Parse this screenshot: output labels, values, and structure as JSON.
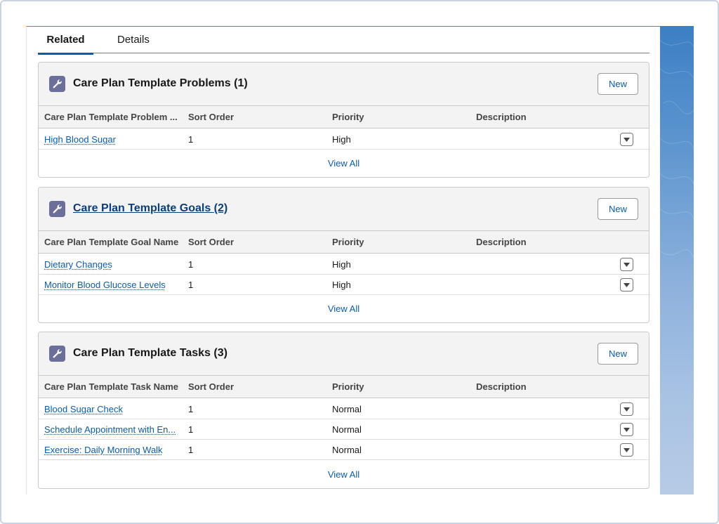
{
  "tabs": {
    "related": "Related",
    "details": "Details"
  },
  "columns": {
    "sort": "Sort Order",
    "priority": "Priority",
    "description": "Description"
  },
  "problems": {
    "title": "Care Plan Template Problems (1)",
    "new_label": "New",
    "name_header": "Care Plan Template Problem ...",
    "rows": [
      {
        "name": "High Blood Sugar",
        "sort": "1",
        "priority": "High",
        "description": ""
      }
    ],
    "view_all": "View All"
  },
  "goals": {
    "title": "Care Plan Template Goals (2)",
    "new_label": "New",
    "name_header": "Care Plan Template Goal Name",
    "rows": [
      {
        "name": "Dietary Changes",
        "sort": "1",
        "priority": "High",
        "description": ""
      },
      {
        "name": "Monitor Blood Glucose Levels",
        "sort": "1",
        "priority": "High",
        "description": ""
      }
    ],
    "view_all": "View All"
  },
  "tasks": {
    "title": "Care Plan Template Tasks (3)",
    "new_label": "New",
    "name_header": "Care Plan Template Task Name",
    "rows": [
      {
        "name": "Blood Sugar Check",
        "sort": "1",
        "priority": "Normal",
        "description": ""
      },
      {
        "name": "Schedule Appointment with En...",
        "sort": "1",
        "priority": "Normal",
        "description": ""
      },
      {
        "name": "Exercise: Daily Morning Walk",
        "sort": "1",
        "priority": "Normal",
        "description": ""
      }
    ],
    "view_all": "View All"
  },
  "icons": {
    "card": "wrench-icon",
    "row_menu": "chevron-down-icon"
  },
  "colors": {
    "accent": "#0b5cab",
    "icon_bg": "#6b6f99",
    "header_bg": "#f3f3f3"
  }
}
